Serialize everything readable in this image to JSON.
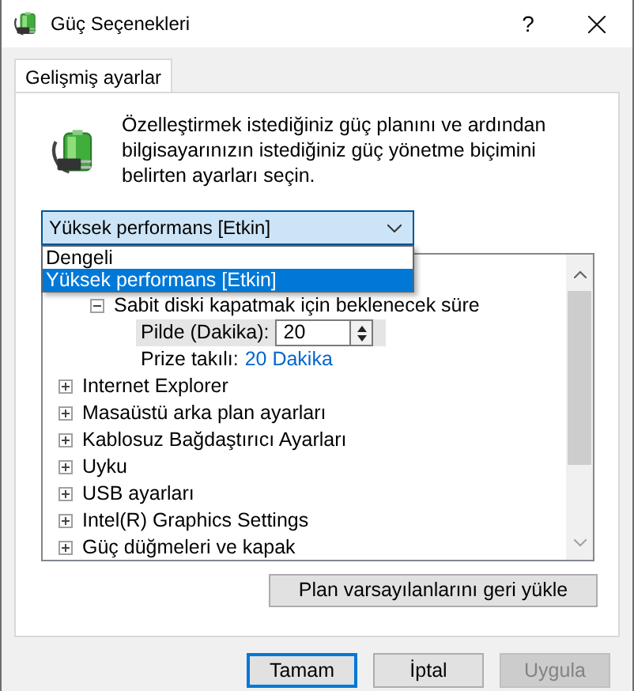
{
  "window": {
    "title": "Güç Seçenekleri",
    "help": "?"
  },
  "tabs": [
    {
      "label": "Gelişmiş ayarlar",
      "selected": true
    }
  ],
  "description": "Özelleştirmek istediğiniz güç planını ve ardından bilgisayarınızın istediğiniz güç yönetme biçimini belirten ayarları seçin.",
  "plan_select": {
    "value": "Yüksek performans [Etkin]",
    "expanded": true,
    "options": [
      {
        "label": "Dengeli",
        "selected": false
      },
      {
        "label": "Yüksek performans [Etkin]",
        "selected": true
      }
    ]
  },
  "settings_tree": [
    {
      "label": "Sabit diski kapatmak için beklenecek süre",
      "expanded": true,
      "children": [
        {
          "kind": "spin",
          "label": "Pilde (Dakika):",
          "value": "20",
          "selected": true
        },
        {
          "kind": "link",
          "label": "Prize takılı:",
          "value": "20 Dakika",
          "selected": false
        }
      ]
    },
    {
      "label": "Internet Explorer",
      "expanded": false
    },
    {
      "label": "Masaüstü arka plan ayarları",
      "expanded": false
    },
    {
      "label": "Kablosuz Bağdaştırıcı Ayarları",
      "expanded": false
    },
    {
      "label": "Uyku",
      "expanded": false
    },
    {
      "label": "USB ayarları",
      "expanded": false
    },
    {
      "label": "Intel(R) Graphics Settings",
      "expanded": false
    },
    {
      "label": "Güç düğmeleri ve kapak",
      "expanded": false
    }
  ],
  "restore_button": "Plan varsayılanlarını geri yükle",
  "buttons": [
    {
      "label": "Tamam",
      "disabled": false,
      "default": true
    },
    {
      "label": "İptal",
      "disabled": false,
      "default": false
    },
    {
      "label": "Uygula",
      "disabled": true,
      "default": false
    }
  ]
}
